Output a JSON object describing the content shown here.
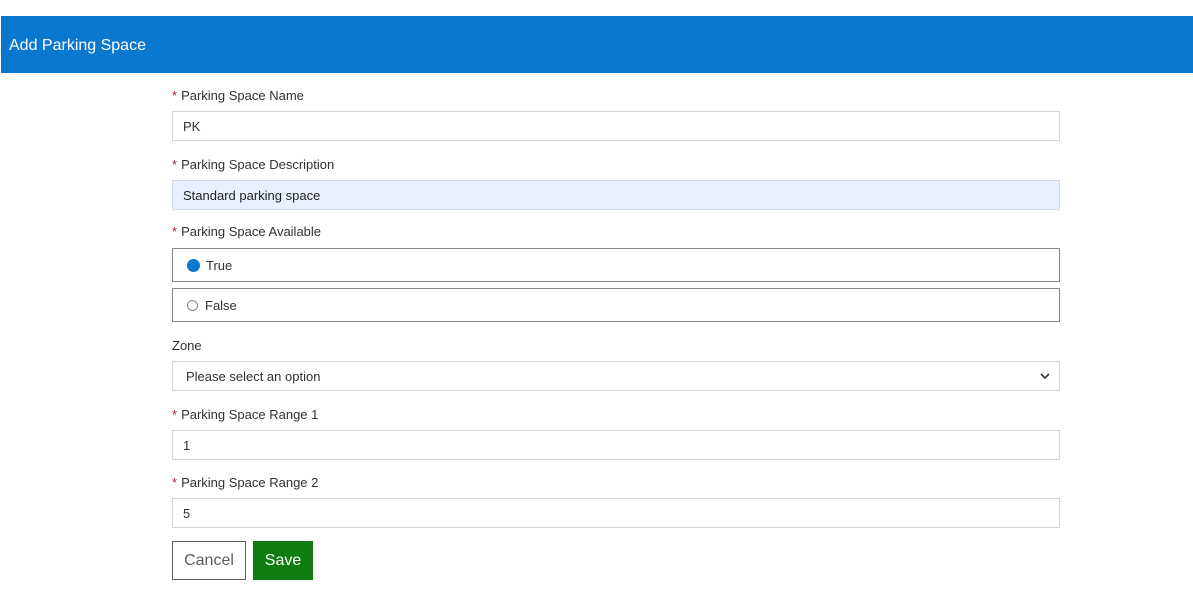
{
  "header": {
    "title": "Add Parking Space"
  },
  "form": {
    "name": {
      "required_mark": "*",
      "label": "Parking Space Name",
      "value": "PK"
    },
    "description": {
      "required_mark": "*",
      "label": "Parking Space Description",
      "value": "Standard parking space"
    },
    "available": {
      "required_mark": "*",
      "label": "Parking Space Available",
      "options": [
        {
          "label": "True",
          "checked": true
        },
        {
          "label": "False",
          "checked": false
        }
      ]
    },
    "zone": {
      "label": "Zone",
      "selected": "Please select an option"
    },
    "range1": {
      "required_mark": "*",
      "label": "Parking Space Range 1",
      "value": "1"
    },
    "range2": {
      "required_mark": "*",
      "label": "Parking Space Range 2",
      "value": "5"
    }
  },
  "actions": {
    "cancel_label": "Cancel",
    "save_label": "Save"
  },
  "colors": {
    "header": "#0b78d0",
    "required": "#a4262c",
    "save": "#107c10",
    "autofill": "#e8f0fe"
  }
}
